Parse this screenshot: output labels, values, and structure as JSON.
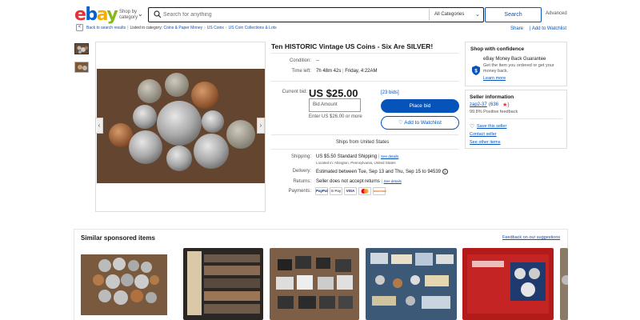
{
  "header": {
    "logo_letters": [
      "e",
      "b",
      "a",
      "y"
    ],
    "shop_by": "Shop by category",
    "search_placeholder": "Search for anything",
    "category": "All Categories",
    "search_button": "Search",
    "advanced": "Advanced"
  },
  "breadcrumb": {
    "back": "Back to search results",
    "listed_in": "Listed in category:",
    "items": [
      "Coins & Paper Money",
      "US Coins",
      "US Coin Collections & Lots"
    ],
    "share": "Share",
    "add_to_watchlist": "Add to Watchlist"
  },
  "item": {
    "title": "Ten HISTORIC Vintage US Coins - Six Are SILVER!",
    "condition_label": "Condition:",
    "condition_value": "--",
    "time_left_label": "Time left:",
    "time_left_value": "7h 48m 42s",
    "time_left_end": "Friday, 4:22AM",
    "current_bid_label": "Current bid:",
    "current_bid": "US $25.00",
    "bids": "[23 bids]",
    "bid_placeholder": "Bid Amount",
    "bid_hint": "Enter US $26.00 or more",
    "place_bid": "Place bid",
    "add_watchlist": "Add to Watchlist",
    "ships_from": "Ships from United States",
    "shipping_label": "Shipping:",
    "shipping_value": "US $5.50 Standard Shipping",
    "see_details": "See details",
    "located_in": "Located in: Abington, Pennsylvania, United States",
    "delivery_label": "Delivery:",
    "delivery_value": "Estimated between Tue, Sep 13 and Thu, Sep 15 to 94539",
    "returns_label": "Returns:",
    "returns_value": "Seller does not accept returns",
    "payments_label": "Payments:",
    "payments": [
      "PayPal",
      "G Pay",
      "VISA",
      "MC",
      "DISCOVER"
    ]
  },
  "confidence": {
    "title": "Shop with confidence",
    "mbg_title": "eBay Money Back Guarantee",
    "mbg_text": "Get the item you ordered or get your money back.",
    "learn_more": "Learn more"
  },
  "seller": {
    "title": "Seller information",
    "name": "zap2-37",
    "feedback": "(636",
    "positive": "99.8% Positive feedback",
    "links": [
      "Save this seller",
      "Contact seller",
      "See other items"
    ]
  },
  "similar": {
    "title": "Similar sponsored items",
    "feedback": "Feedback on our suggestions"
  },
  "colors": {
    "brand_red": "#e53238",
    "brand_blue": "#0064d2",
    "brand_yellow": "#f5af02",
    "brand_green": "#86b817",
    "link": "#0654ba"
  }
}
